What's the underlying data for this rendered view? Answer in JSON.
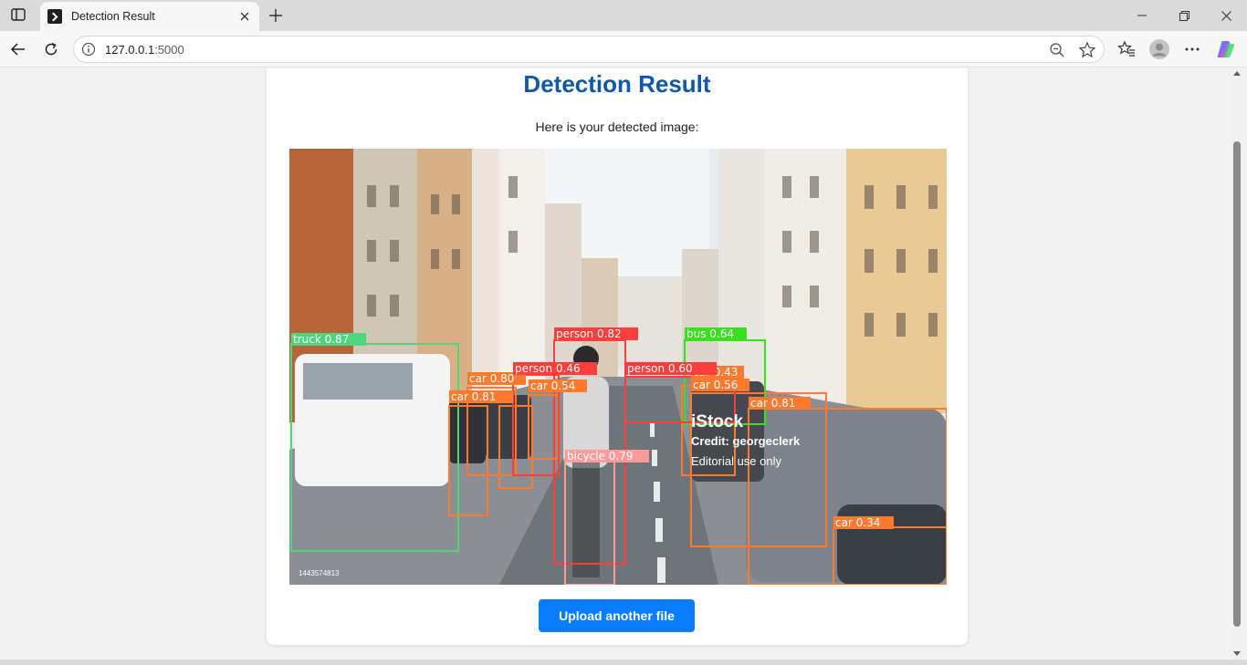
{
  "browser": {
    "tab_title": "Detection Result",
    "address_host": "127.0.0.1",
    "address_port": ":5000"
  },
  "page": {
    "title": "Detection Result",
    "subtitle": "Here is your detected image:",
    "upload_button": "Upload another file"
  },
  "detections": [
    {
      "label": "truck 0.87",
      "color": "#4ed67f"
    },
    {
      "label": "person 0.82",
      "color": "#ff3d3d"
    },
    {
      "label": "bus 0.64",
      "color": "#39e01d"
    },
    {
      "label": "car 0.80",
      "color": "#ff7a2f"
    },
    {
      "label": "car 0.81",
      "color": "#ff7a2f"
    },
    {
      "label": "car 0.81",
      "color": "#ff7a2f"
    },
    {
      "label": "car 0.54",
      "color": "#ff7a2f"
    },
    {
      "label": "car 0.56",
      "color": "#ff7a2f"
    },
    {
      "label": "car 0.43",
      "color": "#ff7a2f"
    },
    {
      "label": "car 0.34",
      "color": "#ff7a2f"
    },
    {
      "label": "person 0.46",
      "color": "#ff3d3d"
    },
    {
      "label": "person 0.60",
      "color": "#ff3d3d"
    },
    {
      "label": "bicycle 0.79",
      "color": "#ff9a9a"
    }
  ],
  "watermark": {
    "brand": "iStock",
    "credit": "Credit: georgeclerk",
    "usage": "Editorial use only",
    "image_id": "1443574813"
  }
}
